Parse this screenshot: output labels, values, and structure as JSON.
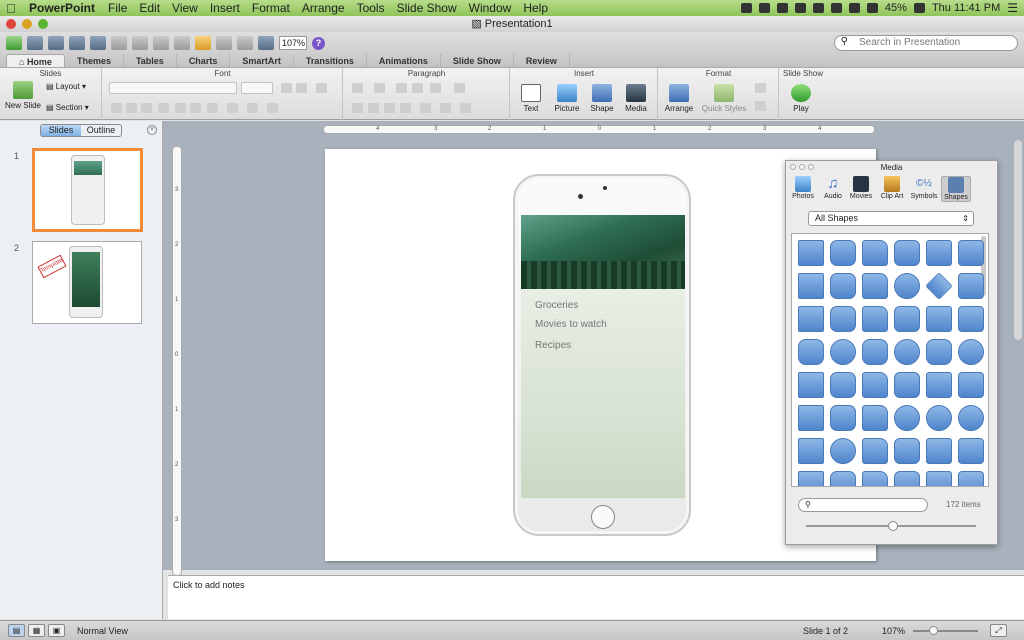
{
  "menubar": {
    "app": "PowerPoint",
    "items": [
      "File",
      "Edit",
      "View",
      "Insert",
      "Format",
      "Arrange",
      "Tools",
      "Slide Show",
      "Window",
      "Help"
    ],
    "battery": "45%",
    "clock": "Thu 11:41 PM"
  },
  "window": {
    "title": "Presentation1"
  },
  "toolbar": {
    "zoom": "107%",
    "help": "?",
    "search_placeholder": "Search in Presentation"
  },
  "ribbon": {
    "tabs": [
      "Home",
      "Themes",
      "Tables",
      "Charts",
      "SmartArt",
      "Transitions",
      "Animations",
      "Slide Show",
      "Review"
    ],
    "groups": {
      "slides": "Slides",
      "font": "Font",
      "paragraph": "Paragraph",
      "insert": "Insert",
      "format": "Format",
      "slideshow": "Slide Show"
    },
    "new_slide": "New Slide",
    "layout": "Layout",
    "section": "Section",
    "text": "Text",
    "picture": "Picture",
    "shape": "Shape",
    "media": "Media",
    "arrange": "Arrange",
    "quick_styles": "Quick Styles",
    "play": "Play"
  },
  "pane": {
    "tab_slides": "Slides",
    "tab_outline": "Outline",
    "slide1_num": "1",
    "slide2_num": "2",
    "stamp": "Template"
  },
  "ruler": {
    "h": [
      "4",
      "3",
      "2",
      "1",
      "0",
      "1",
      "2",
      "3",
      "4"
    ],
    "v": [
      "3",
      "2",
      "1",
      "0",
      "1",
      "2",
      "3"
    ]
  },
  "slide": {
    "menu": [
      "Groceries",
      "Movies to watch",
      "Recipes"
    ]
  },
  "media": {
    "title": "Media",
    "tabs": [
      "Photos",
      "Audio",
      "Movies",
      "Clip Art",
      "Symbols",
      "Shapes"
    ],
    "filter": "All Shapes",
    "count": "172 items"
  },
  "notes": {
    "placeholder": "Click to add notes"
  },
  "status": {
    "view": "Normal View",
    "slide": "Slide 1 of 2",
    "zoom": "107%"
  }
}
